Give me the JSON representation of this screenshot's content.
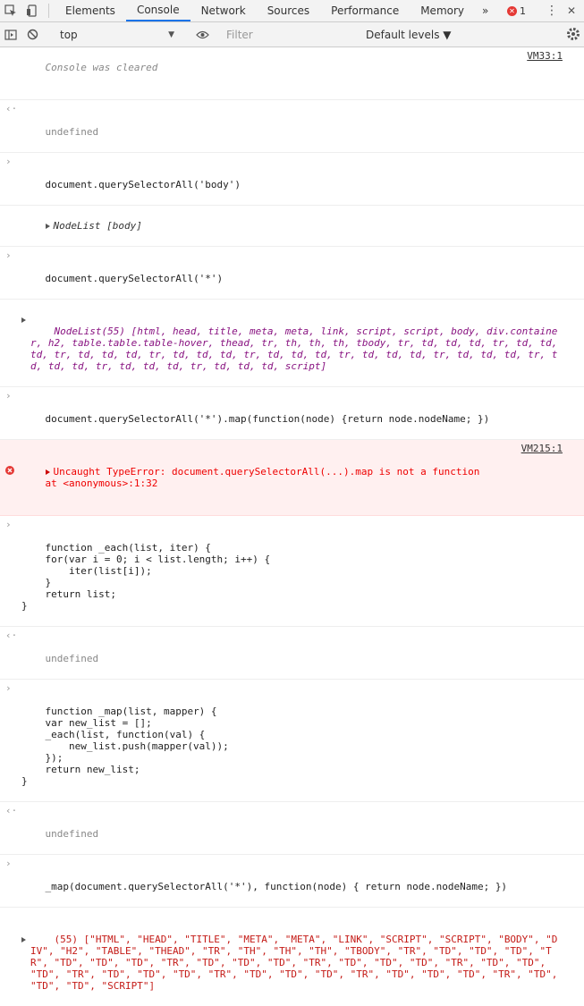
{
  "devtools": {
    "tabs": [
      "Elements",
      "Console",
      "Network",
      "Sources",
      "Performance",
      "Memory"
    ],
    "more_tabs": "»",
    "error_count": "1"
  },
  "filterbar": {
    "context": "top",
    "filter_placeholder": "Filter",
    "levels": "Default levels ▼"
  },
  "console": {
    "cleared": "Console was cleared",
    "cleared_link": "VM33:1",
    "undefined": "undefined",
    "cmd1": "document.querySelectorAll('body')",
    "res1": "NodeList [body]",
    "cmd2": "document.querySelectorAll('*')",
    "res2": "NodeList(55) [html, head, title, meta, meta, link, script, script, body, div.container, h2, table.table.table-hover, thead, tr, th, th, th, tbody, tr, td, td, td, tr, td, td, td, tr, td, td, td, tr, td, td, td, tr, td, td, td, tr, td, td, td, tr, td, td, td, tr, td, td, td, tr, td, td, td, tr, td, td, td, script]",
    "cmd3": "document.querySelectorAll('*').map(function(node) {return node.nodeName; })",
    "error_msg": "Uncaught TypeError: document.querySelectorAll(...).map is not a function\n    at <anonymous>:1:32",
    "error_link": "VM215:1",
    "each_fn": "function _each(list, iter) {\n    for(var i = 0; i < list.length; i++) {\n        iter(list[i]);\n    }\n    return list;\n}",
    "undefined2": "undefined",
    "map_fn": "function _map(list, mapper) {\n    var new_list = [];\n    _each(list, function(val) {\n        new_list.push(mapper(val));\n    });\n    return new_list;\n}",
    "undefined3": "undefined",
    "cmd4": "_map(document.querySelectorAll('*'), function(node) { return node.nodeName; })",
    "res4": "(55) [\"HTML\", \"HEAD\", \"TITLE\", \"META\", \"META\", \"LINK\", \"SCRIPT\", \"SCRIPT\", \"BODY\", \"DIV\", \"H2\", \"TABLE\", \"THEAD\", \"TR\", \"TH\", \"TH\", \"TH\", \"TBODY\", \"TR\", \"TD\", \"TD\", \"TD\", \"TR\", \"TD\", \"TD\", \"TD\", \"TR\", \"TD\", \"TD\", \"TD\", \"TR\", \"TD\", \"TD\", \"TD\", \"TR\", \"TD\", \"TD\", \"TD\", \"TR\", \"TD\", \"TD\", \"TD\", \"TR\", \"TD\", \"TD\", \"TD\", \"TR\", \"TD\", \"TD\", \"TD\", \"TR\", \"TD\", \"TD\", \"TD\", \"SCRIPT\"]"
  }
}
